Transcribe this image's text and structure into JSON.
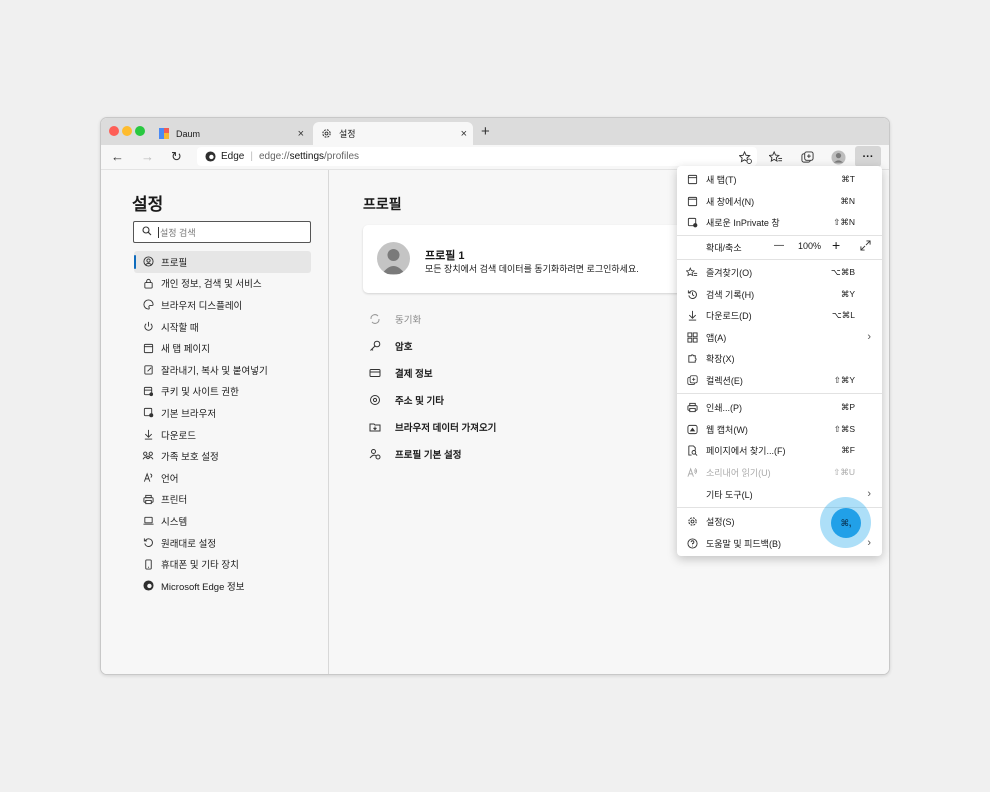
{
  "tabs": [
    {
      "label": "Daum",
      "icon": "daum-favicon",
      "close": "×"
    },
    {
      "label": "설정",
      "icon": "gear-icon",
      "close": "×"
    }
  ],
  "new_tab": "+",
  "address": {
    "site": "Edge",
    "url_prefix": "edge://",
    "url_bold": "settings",
    "url_suffix": "/profiles"
  },
  "sidebar": {
    "title": "설정",
    "search_placeholder": "설정 검색",
    "items": [
      {
        "label": "프로필",
        "icon": "profile-icon"
      },
      {
        "label": "개인 정보, 검색 및 서비스",
        "icon": "lock-icon"
      },
      {
        "label": "브라우저 디스플레이",
        "icon": "palette-icon"
      },
      {
        "label": "시작할 때",
        "icon": "power-icon"
      },
      {
        "label": "새 탭 페이지",
        "icon": "newtab-icon"
      },
      {
        "label": "잘라내기, 복사 및 붙여넣기",
        "icon": "clipboard-icon"
      },
      {
        "label": "쿠키 및 사이트 권한",
        "icon": "cookie-icon"
      },
      {
        "label": "기본 브라우저",
        "icon": "browser-icon"
      },
      {
        "label": "다운로드",
        "icon": "download-icon"
      },
      {
        "label": "가족 보호 설정",
        "icon": "family-icon"
      },
      {
        "label": "언어",
        "icon": "language-icon"
      },
      {
        "label": "프린터",
        "icon": "printer-icon"
      },
      {
        "label": "시스템",
        "icon": "laptop-icon"
      },
      {
        "label": "원래대로 설정",
        "icon": "reset-icon"
      },
      {
        "label": "휴대폰 및 기타 장치",
        "icon": "phone-icon"
      },
      {
        "label": "Microsoft Edge 정보",
        "icon": "edge-icon"
      }
    ]
  },
  "main": {
    "title": "프로필",
    "profile_name": "프로필 1",
    "profile_desc": "모든 장치에서 검색 데이터를 동기화하려면 로그인하세요.",
    "items": [
      {
        "label": "동기화",
        "icon": "sync-icon"
      },
      {
        "label": "암호",
        "icon": "key-icon"
      },
      {
        "label": "결제 정보",
        "icon": "card-icon"
      },
      {
        "label": "주소 및 기타",
        "icon": "location-icon"
      },
      {
        "label": "브라우저 데이터 가져오기",
        "icon": "import-icon"
      },
      {
        "label": "프로필 기본 설정",
        "icon": "profile-settings-icon"
      }
    ]
  },
  "menu": {
    "items": [
      {
        "label": "새 탭(T)",
        "shortcut": "⌘T",
        "icon": "newtab-icon"
      },
      {
        "label": "새 창에서(N)",
        "shortcut": "⌘N",
        "icon": "window-icon"
      },
      {
        "label": "새로운 InPrivate 창",
        "shortcut": "⇧⌘N",
        "icon": "inprivate-icon"
      },
      {
        "label": "즐겨찾기(O)",
        "shortcut": "⌥⌘B",
        "icon": "favorites-icon"
      },
      {
        "label": "검색 기록(H)",
        "shortcut": "⌘Y",
        "icon": "history-icon"
      },
      {
        "label": "다운로드(D)",
        "shortcut": "⌥⌘L",
        "icon": "download-icon"
      },
      {
        "label": "앱(A)",
        "shortcut": "",
        "icon": "apps-icon"
      },
      {
        "label": "확장(X)",
        "shortcut": "",
        "icon": "extensions-icon"
      },
      {
        "label": "컬렉션(E)",
        "shortcut": "⇧⌘Y",
        "icon": "collections-icon"
      },
      {
        "label": "인쇄...(P)",
        "shortcut": "⌘P",
        "icon": "print-icon"
      },
      {
        "label": "웹 캡처(W)",
        "shortcut": "⇧⌘S",
        "icon": "web-capture-icon"
      },
      {
        "label": "페이지에서 찾기...(F)",
        "shortcut": "⌘F",
        "icon": "find-icon"
      },
      {
        "label": "소리내어 읽기(U)",
        "shortcut": "⇧⌘U",
        "icon": "read-aloud-icon"
      },
      {
        "label": "기타 도구(L)",
        "shortcut": "",
        "icon": ""
      },
      {
        "label": "설정(S)",
        "shortcut": "⌘,",
        "icon": "gear-icon"
      },
      {
        "label": "도움말 및 피드백(B)",
        "shortcut": "",
        "icon": "help-icon"
      }
    ],
    "zoom": {
      "label": "확대/축소",
      "minus": "—",
      "value": "100%",
      "plus": "+"
    }
  },
  "more_button": "···",
  "colors": {
    "accent": "#0f6cbd",
    "highlight": "#21a0e8"
  }
}
